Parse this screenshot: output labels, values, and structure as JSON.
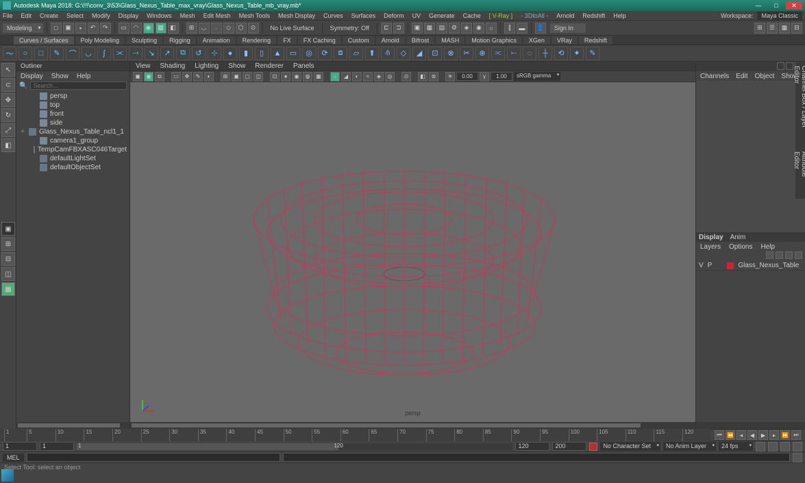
{
  "title": "Autodesk Maya 2018: G:\\!!!\\conv_3\\53\\Glass_Nexus_Table_max_vray\\Glass_Nexus_Table_mb_vray.mb*",
  "menus": [
    "File",
    "Edit",
    "Create",
    "Select",
    "Modify",
    "Display",
    "Windows",
    "Mesh",
    "Edit Mesh",
    "Mesh Tools",
    "Mesh Display",
    "Curves",
    "Surfaces",
    "Deform",
    "UV",
    "Generate",
    "Cache"
  ],
  "vray": "[ V-Ray ]",
  "mgear": "- 3DtoAll -",
  "menus2": [
    "Arnold",
    "Redshift",
    "Help"
  ],
  "workspace_lbl": "Workspace:",
  "workspace": "Maya Classic",
  "mode": "Modeling",
  "nolive": "No Live Surface",
  "symmetry": "Symmetry: Off",
  "signin": "Sign In",
  "shelf_tabs": [
    "Curves / Surfaces",
    "Poly Modeling",
    "Sculpting",
    "Rigging",
    "Animation",
    "Rendering",
    "FX",
    "FX Caching",
    "Custom",
    "Arnold",
    "Bifrost",
    "MASH",
    "Motion Graphics",
    "XGen",
    "VRay",
    "Redshift"
  ],
  "outliner": {
    "title": "Outliner",
    "menus": [
      "Display",
      "Show",
      "Help"
    ],
    "search": "Search...",
    "items": [
      {
        "label": "persp",
        "dim": true,
        "cam": true,
        "ind": 1
      },
      {
        "label": "top",
        "dim": true,
        "cam": true,
        "ind": 1
      },
      {
        "label": "front",
        "dim": true,
        "cam": true,
        "ind": 1
      },
      {
        "label": "side",
        "dim": true,
        "cam": true,
        "ind": 1
      },
      {
        "label": "Glass_Nexus_Table_ncl1_1",
        "exp": "+",
        "ind": 0
      },
      {
        "label": "camera1_group",
        "cam": true,
        "ind": 1
      },
      {
        "label": "TempCamFBXASC046Target",
        "ind": 1
      },
      {
        "label": "defaultLightSet",
        "ind": 1
      },
      {
        "label": "defaultObjectSet",
        "ind": 1
      }
    ]
  },
  "vp_menus": [
    "View",
    "Shading",
    "Lighting",
    "Show",
    "Renderer",
    "Panels"
  ],
  "vp_exp": "0.00",
  "vp_gamma": "1.00",
  "vp_cs": "sRGB gamma",
  "vp_cam": "persp",
  "channels": [
    "Channels",
    "Edit",
    "Object",
    "Show"
  ],
  "display_tabs": [
    "Display",
    "Anim"
  ],
  "layer_menus": [
    "Layers",
    "Options",
    "Help"
  ],
  "layer": {
    "v": "V",
    "p": "P",
    "name": "Glass_Nexus_Table"
  },
  "range": {
    "s1": "1",
    "s2": "1",
    "s3": "1",
    "e1": "120",
    "e2": "120",
    "e3": "200"
  },
  "charset": "No Character Set",
  "animlayer": "No Anim Layer",
  "fps": "24 fps",
  "mel": "MEL",
  "help": "Select Tool: select an object",
  "timeline_ticks": [
    1,
    5,
    10,
    15,
    20,
    25,
    30,
    35,
    40,
    45,
    50,
    55,
    60,
    65,
    70,
    75,
    80,
    85,
    90,
    95,
    100,
    105,
    110,
    115,
    120
  ]
}
